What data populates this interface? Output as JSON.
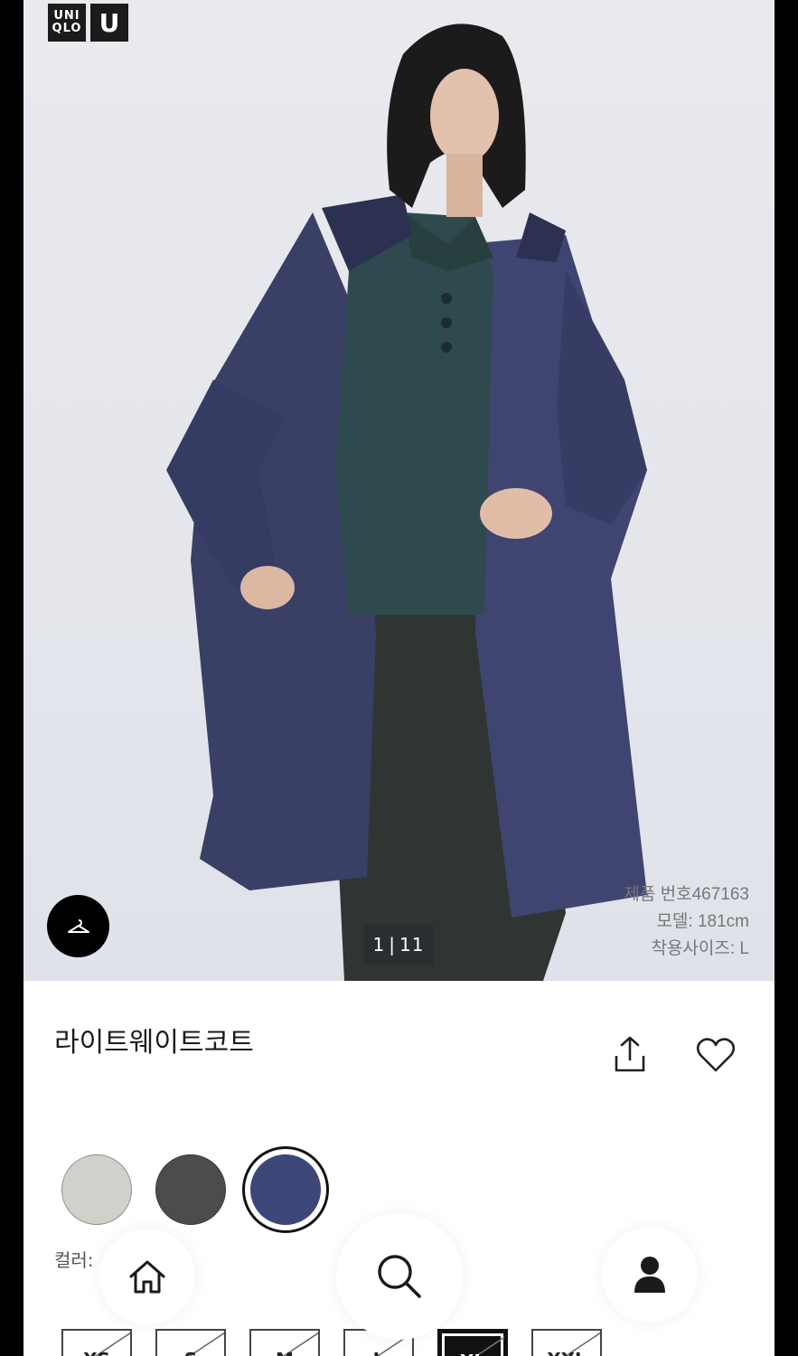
{
  "brand": {
    "logo_text_1": "UNI",
    "logo_text_2": "QLO",
    "logo_text_3": "U"
  },
  "gallery": {
    "current": "1",
    "total": "11"
  },
  "photo_meta": {
    "product_number": "제품 번호467163",
    "model_height": "모델: 181cm",
    "wear_size": "착용사이즈: L"
  },
  "product": {
    "title": "라이트웨이트코트"
  },
  "colors": {
    "label": "컬러:",
    "swatches": [
      {
        "hex": "#cfd2cb",
        "selected": false
      },
      {
        "hex": "#4b4c4e",
        "selected": false
      },
      {
        "hex": "#3c4677",
        "selected": true
      }
    ]
  },
  "sizes": [
    {
      "label": "XS",
      "available": false,
      "selected": false
    },
    {
      "label": "S",
      "available": false,
      "selected": false
    },
    {
      "label": "M",
      "available": false,
      "selected": false
    },
    {
      "label": "L",
      "available": false,
      "selected": false
    },
    {
      "label": "XL",
      "available": false,
      "selected": true
    },
    {
      "label": "XXL",
      "available": false,
      "selected": false
    }
  ],
  "nav": {
    "icons": [
      "home-icon",
      "search-icon",
      "user-icon"
    ]
  }
}
